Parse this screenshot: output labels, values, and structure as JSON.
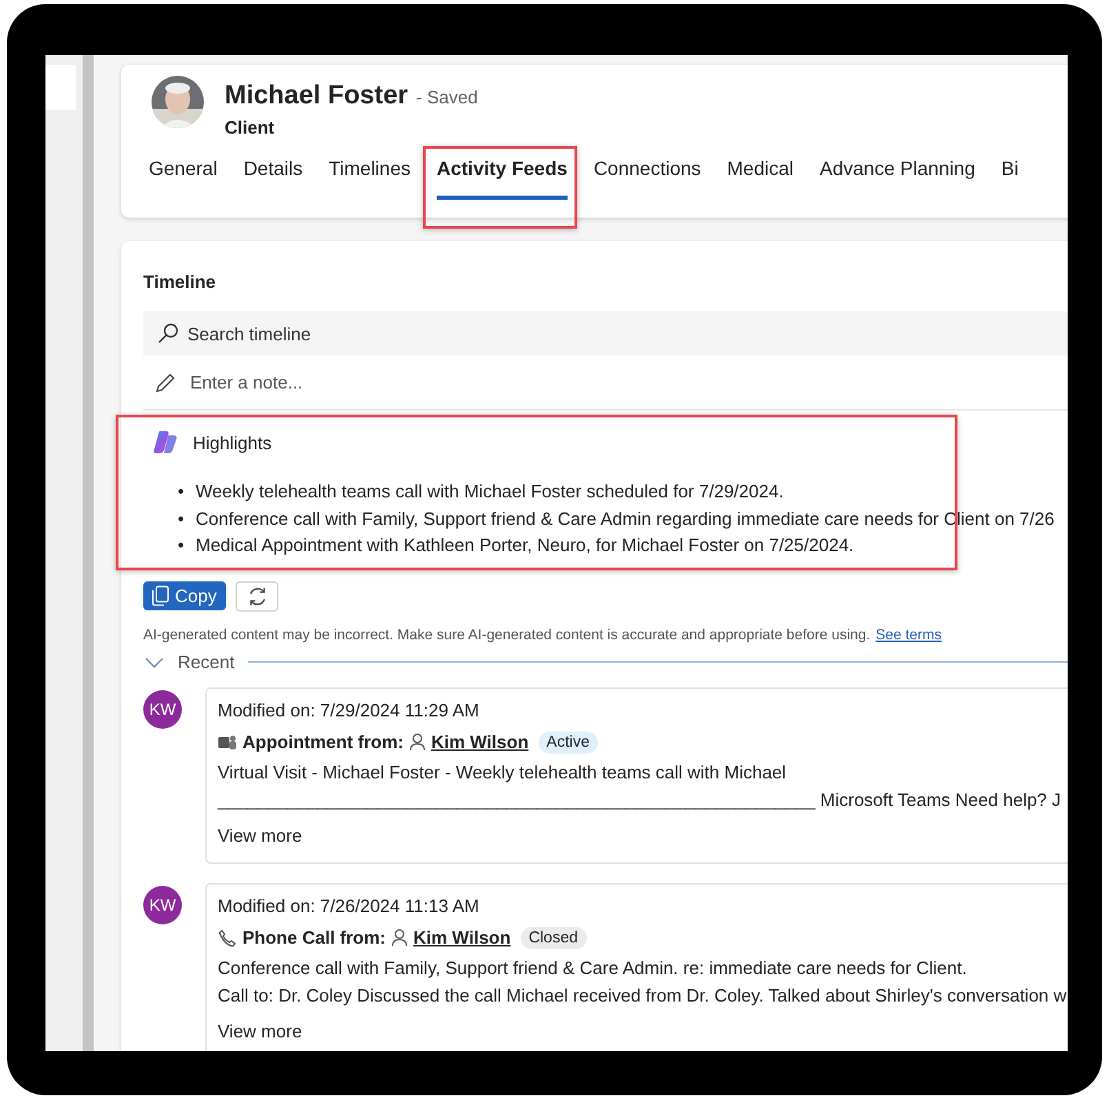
{
  "record": {
    "name": "Michael Foster",
    "save_state": "- Saved",
    "entity": "Client"
  },
  "tabs": [
    {
      "label": "General",
      "selected": false
    },
    {
      "label": "Details",
      "selected": false
    },
    {
      "label": "Timelines",
      "selected": false
    },
    {
      "label": "Activity Feeds",
      "selected": true,
      "highlighted": true
    },
    {
      "label": "Connections",
      "selected": false
    },
    {
      "label": "Medical",
      "selected": false
    },
    {
      "label": "Advance Planning",
      "selected": false
    },
    {
      "label": "Bi",
      "selected": false
    }
  ],
  "timeline": {
    "title": "Timeline",
    "search": {
      "placeholder": "Search timeline"
    },
    "note": {
      "placeholder": "Enter a note..."
    },
    "highlights": {
      "title": "Highlights",
      "highlighted": true,
      "items": [
        {
          "marker": "•",
          "text": "Weekly telehealth teams call with Michael Foster scheduled for 7/29/2024."
        },
        {
          "marker": "•",
          "text": "Conference call with Family, Support friend & Care Admin regarding immediate care needs for Client on 7/26"
        },
        {
          "marker": "•",
          "text": "Medical Appointment with Kathleen Porter, Neuro, for Michael Foster on 7/25/2024."
        }
      ]
    },
    "copy_button": "Copy",
    "disclaimer": "AI-generated content may be incorrect. Make sure AI-generated content is accurate and appropriate before using.",
    "terms_link": "See terms",
    "group": {
      "label": "Recent",
      "expanded": true
    },
    "entries": [
      {
        "initials": "KW",
        "modified": "Modified on: 7/29/2024 11:29 AM",
        "kind": "appointment",
        "type_label": "Appointment from:",
        "person": "Kim Wilson",
        "status": "Active",
        "color": "#dff0fb",
        "lines": [
          "Virtual Visit - Michael Foster - Weekly telehealth teams call with Michael",
          "____________________________________________________________ Microsoft Teams Need help? J"
        ],
        "more": "View more"
      },
      {
        "initials": "KW",
        "modified": "Modified on: 7/26/2024 11:13 AM",
        "kind": "phone_call",
        "type_label": "Phone Call from:",
        "person": "Kim Wilson",
        "status": "Closed",
        "color": "#ebebeb",
        "lines": [
          "Conference call with Family, Support friend & Care Admin. re: immediate care needs for Client.",
          "Call to: Dr. Coley Discussed the call Michael received from Dr. Coley. Talked about Shirley's conversation w"
        ],
        "more": "View more"
      }
    ]
  }
}
